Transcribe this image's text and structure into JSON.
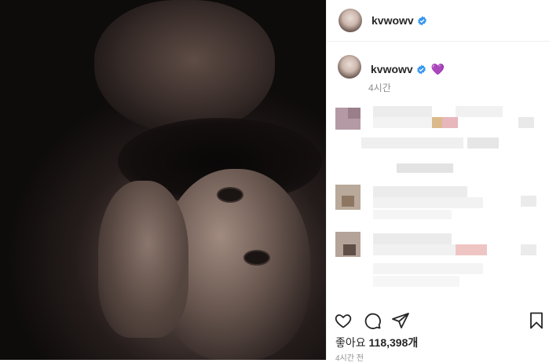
{
  "post": {
    "username": "kvwowv",
    "caption_emoji": "💜",
    "caption_time": "4시간",
    "likes_label": "좋아요",
    "likes_count": "118,398개",
    "posted_ago": "4시간 전"
  },
  "icons": {
    "like": "heart-outline-icon",
    "comment": "comment-icon",
    "share": "paper-plane-icon",
    "save": "bookmark-icon",
    "verified": "verified-badge-icon"
  },
  "colors": {
    "verified": "#3897f0",
    "heart_emoji": "#8e5cc8",
    "secondary_text": "#8e8e8e"
  }
}
